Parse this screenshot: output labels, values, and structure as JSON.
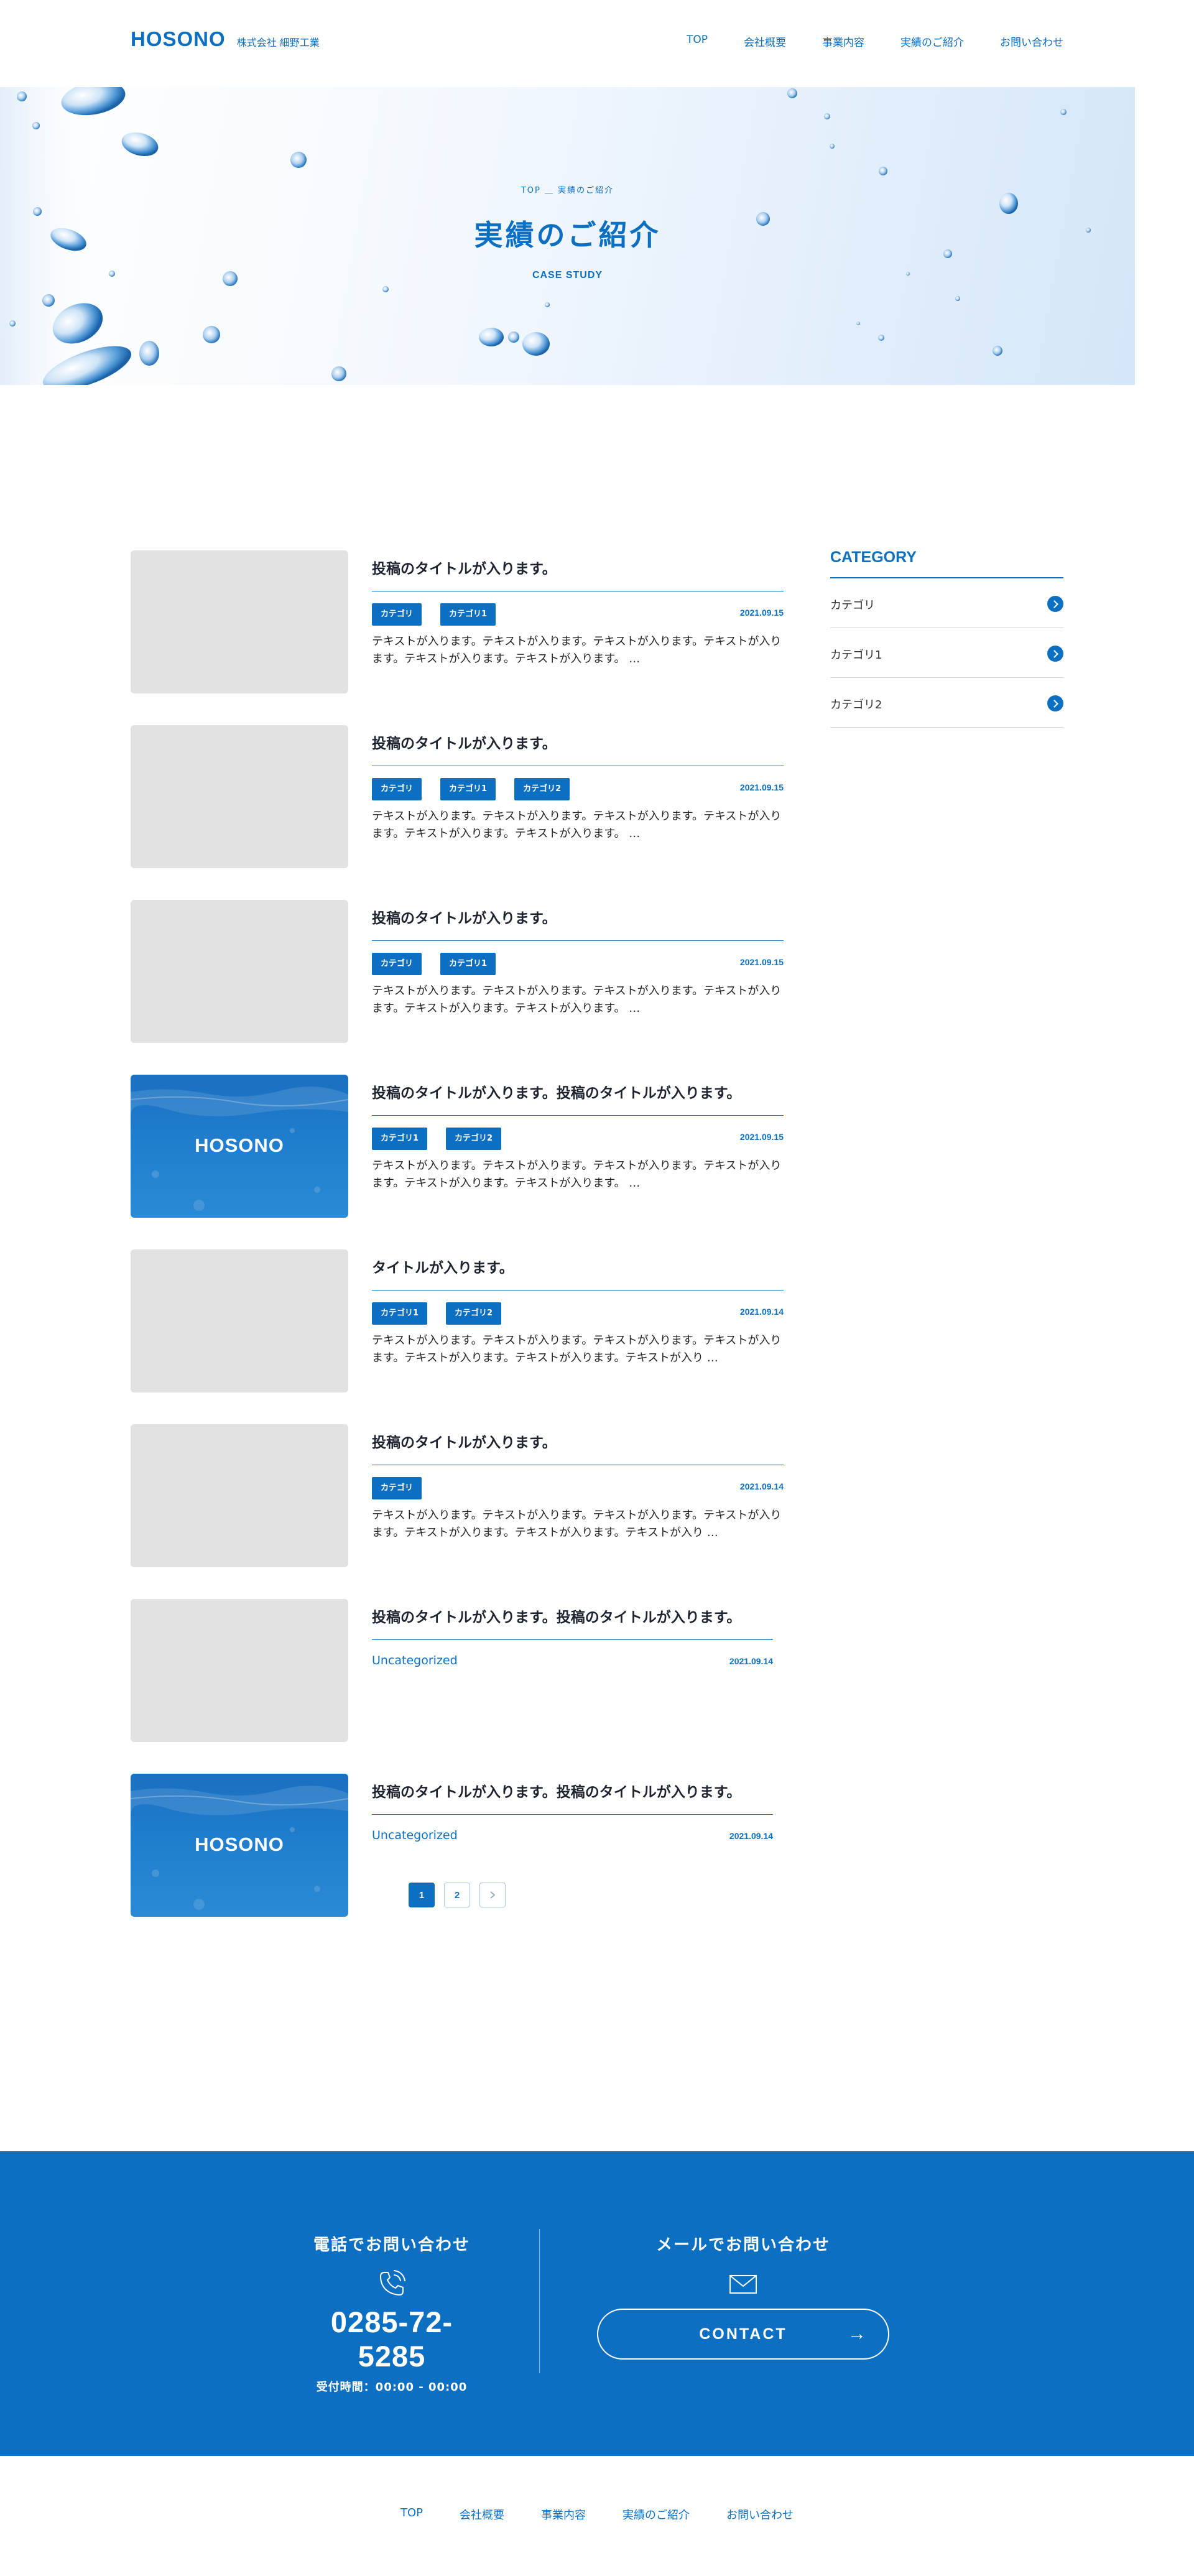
{
  "header": {
    "logo": "HOSONO",
    "company": "株式会社 細野工業",
    "nav": [
      "TOP",
      "会社概要",
      "事業内容",
      "実績のご紹介",
      "お問い合わせ"
    ]
  },
  "hero": {
    "breadcrumb": "TOP ＿ 実績のご紹介",
    "title": "実績のご紹介",
    "subtitle": "CASE STUDY"
  },
  "posts": [
    {
      "title": "投稿のタイトルが入ります。",
      "tags": [
        "カテゴリ",
        "カテゴリ1"
      ],
      "date": "2021.09.15",
      "excerpt": "テキストが入ります。テキストが入ります。テキストが入ります。テキストが入ります。テキストが入ります。テキストが入ります。 …",
      "thumb": "placeholder"
    },
    {
      "title": "投稿のタイトルが入ります。",
      "tags": [
        "カテゴリ",
        "カテゴリ1",
        "カテゴリ2"
      ],
      "date": "2021.09.15",
      "excerpt": "テキストが入ります。テキストが入ります。テキストが入ります。テキストが入ります。テキストが入ります。テキストが入ります。 …",
      "thumb": "placeholder"
    },
    {
      "title": "投稿のタイトルが入ります。",
      "tags": [
        "カテゴリ",
        "カテゴリ1"
      ],
      "date": "2021.09.15",
      "excerpt": "テキストが入ります。テキストが入ります。テキストが入ります。テキストが入ります。テキストが入ります。テキストが入ります。 …",
      "thumb": "placeholder"
    },
    {
      "title": "投稿のタイトルが入ります。投稿のタイトルが入ります。",
      "tags": [
        "カテゴリ1",
        "カテゴリ2"
      ],
      "date": "2021.09.15",
      "excerpt": "テキストが入ります。テキストが入ります。テキストが入ります。テキストが入ります。テキストが入ります。テキストが入ります。 …",
      "thumb": "brand",
      "thumb_label": "HOSONO"
    },
    {
      "title": "タイトルが入ります。",
      "tags": [
        "カテゴリ1",
        "カテゴリ2"
      ],
      "date": "2021.09.14",
      "excerpt": "テキストが入ります。テキストが入ります。テキストが入ります。テキストが入ります。テキストが入ります。テキストが入ります。テキストが入り …",
      "thumb": "placeholder"
    },
    {
      "title": "投稿のタイトルが入ります。",
      "tags": [
        "カテゴリ"
      ],
      "date": "2021.09.14",
      "excerpt": "テキストが入ります。テキストが入ります。テキストが入ります。テキストが入ります。テキストが入ります。テキストが入ります。テキストが入り …",
      "thumb": "placeholder"
    },
    {
      "title": "投稿のタイトルが入ります。投稿のタイトルが入ります。",
      "category": "Uncategorized",
      "date": "2021.09.14",
      "thumb": "placeholder"
    },
    {
      "title": "投稿のタイトルが入ります。投稿のタイトルが入ります。",
      "category": "Uncategorized",
      "date": "2021.09.14",
      "thumb": "brand",
      "thumb_label": "HOSONO"
    }
  ],
  "sidebar": {
    "heading": "CATEGORY",
    "items": [
      "カテゴリ",
      "カテゴリ1",
      "カテゴリ2"
    ],
    "arrow_icon": "chevron-right-icon"
  },
  "pagination": {
    "pages": [
      "1",
      "2"
    ],
    "current": "1",
    "next_icon": "chevron-right-icon"
  },
  "contact": {
    "phone_heading": "電話でお問い合わせ",
    "phone_icon": "phone-icon",
    "phone": "0285-72-5285",
    "hours": "受付時間：00:00 - 00:00",
    "mail_heading": "メールでお問い合わせ",
    "mail_icon": "mail-icon",
    "button": "CONTACT",
    "button_arrow": "→"
  },
  "footer": {
    "nav": [
      "TOP",
      "会社概要",
      "事業内容",
      "実績のご紹介",
      "お問い合わせ"
    ]
  },
  "colors": {
    "brand": "#0d6fc1",
    "placeholder": "#e2e2e2"
  }
}
